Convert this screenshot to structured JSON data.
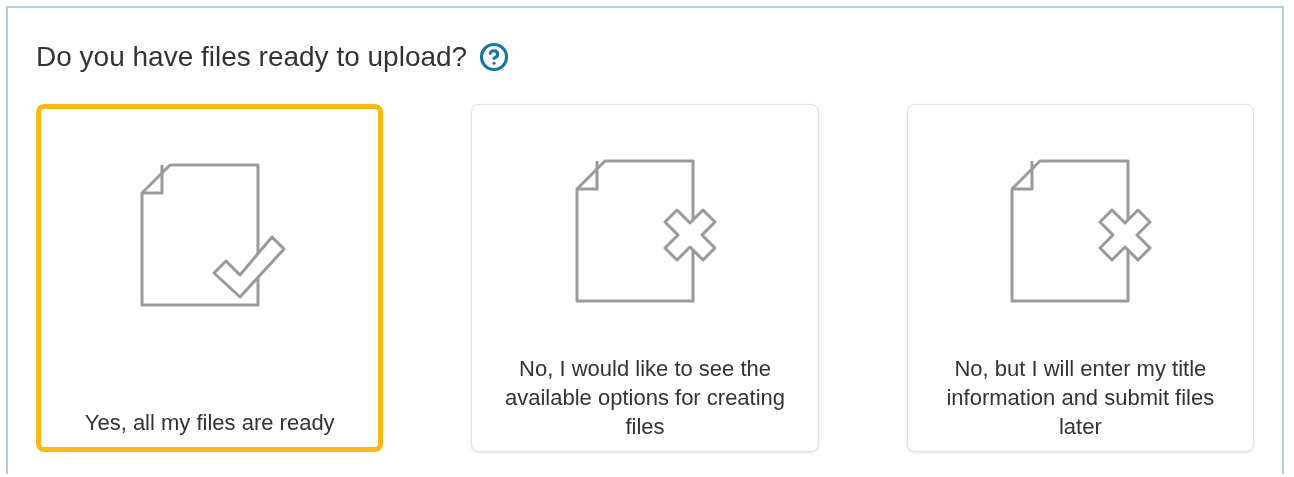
{
  "question": {
    "title": "Do you have files ready to upload?"
  },
  "options": [
    {
      "label": "Yes, all my files are ready",
      "kind": "check",
      "selected": true
    },
    {
      "label": "No, I would like to see the available options for creating files",
      "kind": "cross",
      "selected": false
    },
    {
      "label": "No, but I will enter my title information and submit files later",
      "kind": "cross",
      "selected": false
    }
  ]
}
